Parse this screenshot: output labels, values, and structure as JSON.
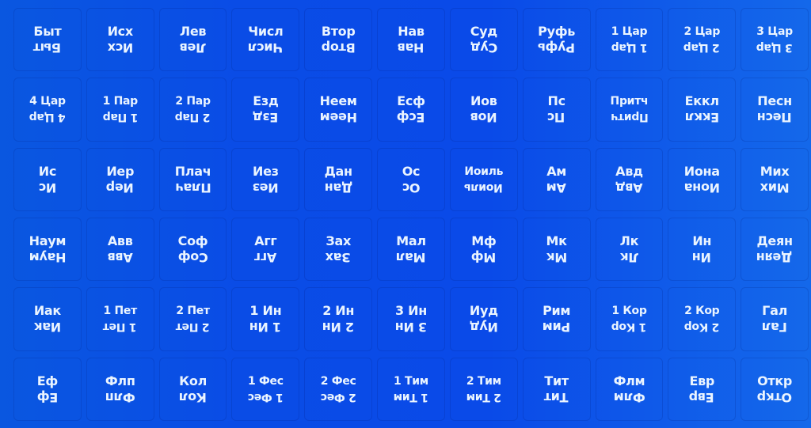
{
  "sheet": {
    "title": "Bible book index tabs",
    "background_color": "#0a4ce6",
    "text_color": "#eaf4ff",
    "rows": [
      [
        "Быт",
        "Исх",
        "Лев",
        "Числ",
        "Втор",
        "Нав",
        "Суд",
        "Руфь",
        "1 Цар",
        "2 Цар",
        "3 Цар"
      ],
      [
        "4 Цар",
        "1 Пар",
        "2 Пар",
        "Езд",
        "Неем",
        "Есф",
        "Иов",
        "Пс",
        "Притч",
        "Еккл",
        "Песн"
      ],
      [
        "Ис",
        "Иер",
        "Плач",
        "Иез",
        "Дан",
        "Ос",
        "Иоиль",
        "Ам",
        "Авд",
        "Иона",
        "Мих"
      ],
      [
        "Наум",
        "Авв",
        "Соф",
        "Агг",
        "Зах",
        "Мал",
        "Мф",
        "Мк",
        "Лк",
        "Ин",
        "Деян"
      ],
      [
        "Иак",
        "1 Пет",
        "2 Пет",
        "1 Ин",
        "2 Ин",
        "3 Ин",
        "Иуд",
        "Рим",
        "1 Кор",
        "2 Кор",
        "Гал"
      ],
      [
        "Еф",
        "Флп",
        "Кол",
        "1 Фес",
        "2 Фес",
        "1 Тим",
        "2 Тим",
        "Тит",
        "Флм",
        "Евр",
        "Откр"
      ]
    ]
  }
}
